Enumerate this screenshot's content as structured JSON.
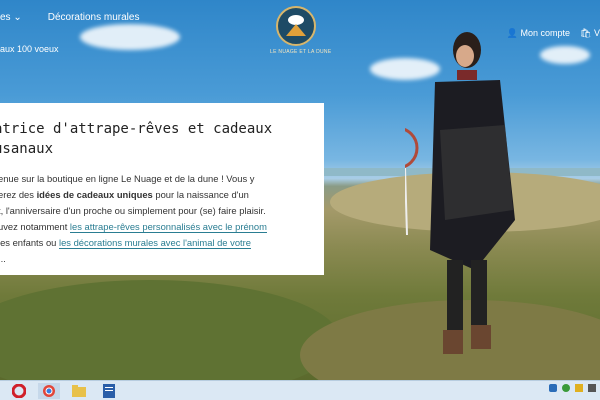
{
  "header": {
    "nav_item_1": "es",
    "nav_item_2": "Décorations murales",
    "nav_item_3": "aux 100 voeux",
    "account_label": "Mon compte",
    "cart_label": "V",
    "logo_text": "LE NUAGE ET LA DUNE"
  },
  "card": {
    "title_line_1": "atrice d'attrape-rêves et cadeaux",
    "title_line_2": "usanaux",
    "p_1": "enue sur la boutique en ligne Le Nuage et de la dune ! Vous y",
    "p_2a": "erez des ",
    "p_2b": "idées de cadeaux uniques",
    "p_2c": " pour la naissance d'un",
    "p_3": "t, l'anniversaire d'un proche ou simplement pour (se) faire plaisir.",
    "p_4a": "uvez notamment ",
    "p_4link": "les attrape-rêves personnalisés avec le prénom",
    "p_5a": "les enfants ou ",
    "p_5link": "les décorations murales avec l'animal de votre",
    "p_6": "..."
  },
  "colors": {
    "link": "#2a7d92",
    "logo_bg": "#1e4b66",
    "logo_ring": "#d7b66c"
  }
}
